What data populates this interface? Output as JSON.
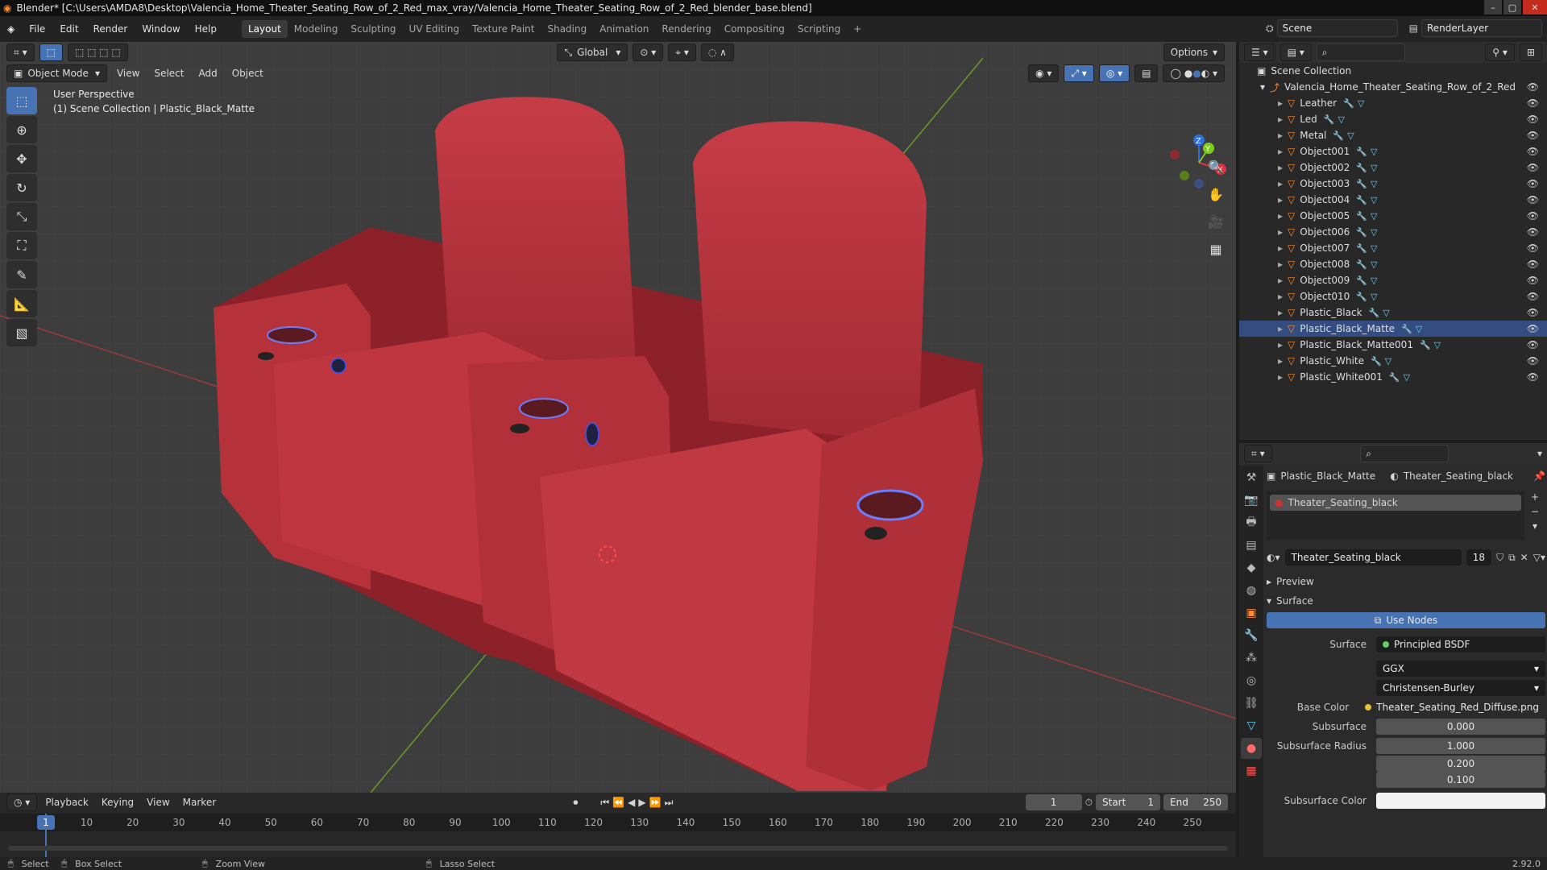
{
  "titlebar": {
    "title": "Blender* [C:\\Users\\AMDA8\\Desktop\\Valencia_Home_Theater_Seating_Row_of_2_Red_max_vray/Valencia_Home_Theater_Seating_Row_of_2_Red_blender_base.blend]"
  },
  "menu": [
    "File",
    "Edit",
    "Render",
    "Window",
    "Help"
  ],
  "workspaces": [
    "Layout",
    "Modeling",
    "Sculpting",
    "UV Editing",
    "Texture Paint",
    "Shading",
    "Animation",
    "Rendering",
    "Compositing",
    "Scripting"
  ],
  "active_workspace": "Layout",
  "scene": "Scene",
  "render_layer": "RenderLayer",
  "viewport": {
    "orientation": "Global",
    "options": "Options",
    "mode": "Object Mode",
    "header_menu": [
      "View",
      "Select",
      "Add",
      "Object"
    ],
    "info_line1": "User Perspective",
    "info_line2": "(1) Scene Collection | Plastic_Black_Matte",
    "gizmo": {
      "x": "X",
      "y": "Y",
      "z": "Z"
    }
  },
  "outliner": {
    "root": "Scene Collection",
    "collection": "Valencia_Home_Theater_Seating_Row_of_2_Red",
    "items": [
      "Leather",
      "Led",
      "Metal",
      "Object001",
      "Object002",
      "Object003",
      "Object004",
      "Object005",
      "Object006",
      "Object007",
      "Object008",
      "Object009",
      "Object010",
      "Plastic_Black",
      "Plastic_Black_Matte",
      "Plastic_Black_Matte001",
      "Plastic_White",
      "Plastic_White001"
    ],
    "selected": "Plastic_Black_Matte"
  },
  "properties": {
    "object": "Plastic_Black_Matte",
    "material": "Theater_Seating_black",
    "slot": "Theater_Seating_black",
    "material_field": "Theater_Seating_black",
    "users": "18",
    "preview": "Preview",
    "surface_panel": "Surface",
    "use_nodes": "Use Nodes",
    "surface_label": "Surface",
    "surface_value": "Principled BSDF",
    "distribution": "GGX",
    "subsurface_method": "Christensen-Burley",
    "base_color_label": "Base Color",
    "base_color_value": "Theater_Seating_Red_Diffuse.png",
    "subsurface_label": "Subsurface",
    "subsurface_value": "0.000",
    "subsurface_radius_label": "Subsurface Radius",
    "subsurface_radius": [
      "1.000",
      "0.200",
      "0.100"
    ],
    "subsurface_color_label": "Subsurface Color"
  },
  "timeline": {
    "menus": [
      "Playback",
      "Keying",
      "View",
      "Marker"
    ],
    "current_frame": "1",
    "start_label": "Start",
    "start": "1",
    "end_label": "End",
    "end": "250",
    "ticks": [
      "10",
      "20",
      "30",
      "40",
      "50",
      "60",
      "70",
      "80",
      "90",
      "100",
      "110",
      "120",
      "130",
      "140",
      "150",
      "160",
      "170",
      "180",
      "190",
      "200",
      "210",
      "220",
      "230",
      "240",
      "250"
    ]
  },
  "statusbar": {
    "select": "Select",
    "box_select": "Box Select",
    "zoom_view": "Zoom View",
    "lasso_select": "Lasso Select",
    "version": "2.92.0"
  },
  "colors": {
    "accent": "#4772b3",
    "seat": "#b5343c",
    "mesh_icon": "#ff8a2b"
  }
}
